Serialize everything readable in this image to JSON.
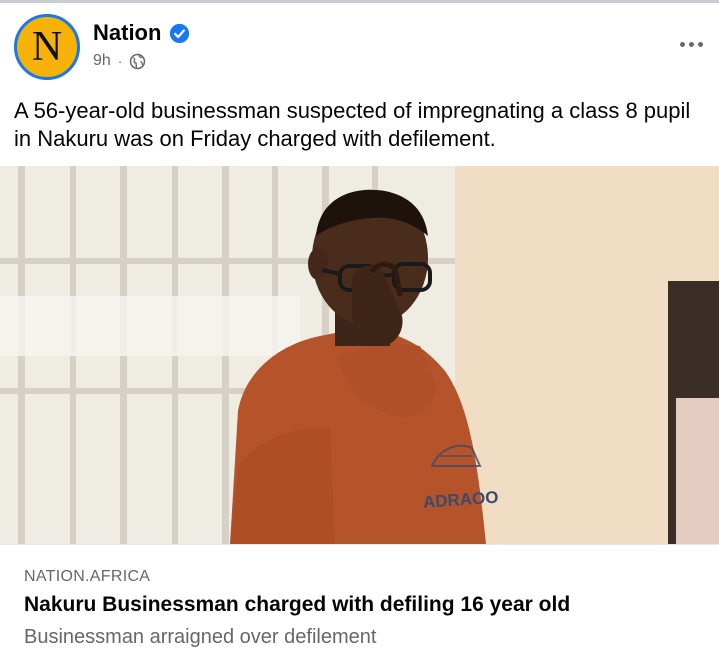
{
  "post": {
    "page_name": "Nation",
    "avatar_letter": "N",
    "time": "9h",
    "separator": "·",
    "audience_icon": "globe-icon",
    "verified_icon": "verified-badge-icon",
    "more_icon": "more-options-icon",
    "text": "A 56-year-old businessman suspected of impregnating a class 8 pupil in Nakuru was on Friday charged with defilement."
  },
  "link_preview": {
    "domain": "NATION.AFRICA",
    "title": "Nakuru Businessman charged with defiling 16 year old",
    "description": "Businessman arraigned over defilement"
  },
  "photo": {
    "shirt_text": "ADRAOO"
  },
  "colors": {
    "brand_blue": "#1877f2",
    "avatar_yellow": "#f5b400",
    "secondary_text": "#65676b",
    "sweater": "#b5542a"
  }
}
